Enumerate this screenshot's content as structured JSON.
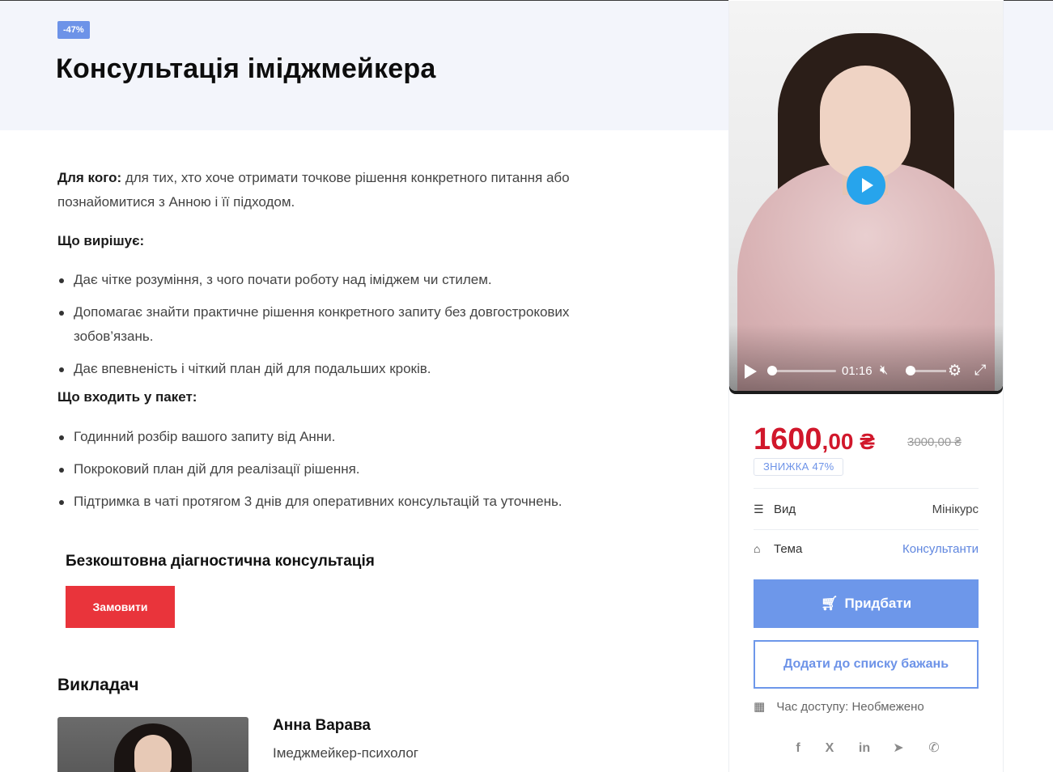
{
  "header": {
    "badge": "-47%",
    "title": "Консультація іміджмейкера"
  },
  "description": {
    "for_whom_label": "Для кого:",
    "for_whom_text": " для тих, хто хоче отримати точкове рішення конкретного питання або познайомитися з Анною і її підходом.",
    "solves_heading": "Що вирішує:",
    "solves_items": [
      "Дає чітке розуміння, з чого почати роботу над іміджем чи стилем.",
      "Допомагає знайти практичне рішення конкретного запиту без довгострокових зобов’язань.",
      "Дає впевненість і чіткий план дій для подальших кроків."
    ],
    "package_heading": "Що входить у пакет:",
    "package_items": [
      "Годинний розбір вашого запиту від Анни.",
      "Покроковий план дій для реалізації рішення.",
      "Підтримка в чаті протягом 3 днів для оперативних консультацій та уточнень."
    ]
  },
  "free_consult": {
    "title": "Безкоштовна діагностична консультація",
    "button": "Замовити"
  },
  "teacher": {
    "heading": "Викладач",
    "name": "Анна Варава",
    "role": "Імеджмейкер-психолог"
  },
  "video": {
    "time": "01:16",
    "progress": 0.0,
    "volume": 0.0
  },
  "pricing": {
    "price_main": "1600",
    "price_cents": ",00 ₴",
    "old_price": "3000,00 ₴",
    "discount_label": "ЗНИЖКА 47%",
    "accent_color": "#d1172b"
  },
  "meta": {
    "type_label": "Вид",
    "type_value": "Мінікурс",
    "topic_label": "Тема",
    "topic_value": "Консультанти"
  },
  "actions": {
    "buy": "Придбати",
    "wishlist": "Додати до списку бажань",
    "access_label": "Час доступу:",
    "access_value": "Необмежено"
  },
  "socials": {
    "facebook": "f",
    "x": "X",
    "linkedin": "in"
  },
  "colors": {
    "brand_blue": "#6d97ea",
    "order_red": "#e9343b",
    "play_blue": "#27a4ec"
  }
}
